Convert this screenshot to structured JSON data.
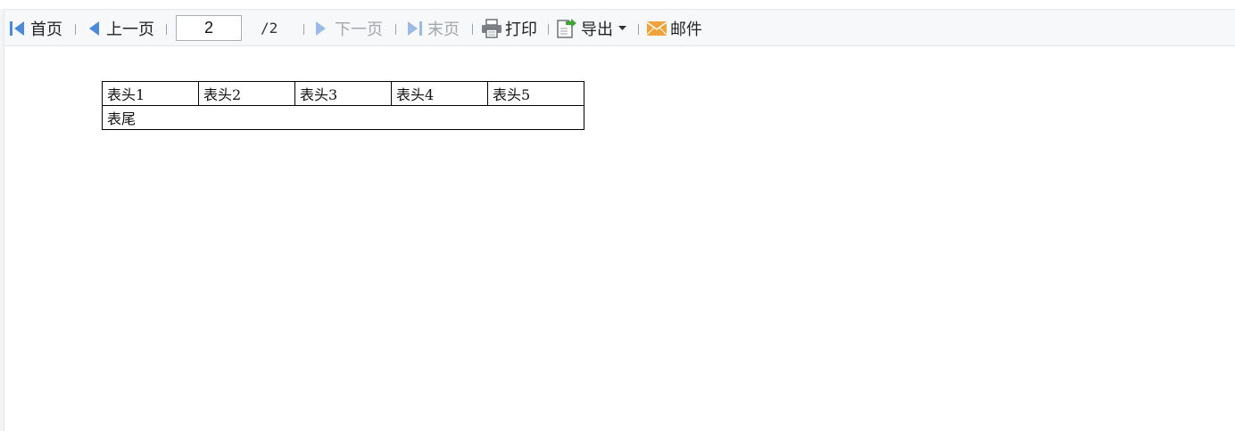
{
  "toolbar": {
    "first_label": "首页",
    "prev_label": "上一页",
    "current_page": "2",
    "total_pages": "/2",
    "next_label": "下一页",
    "last_label": "末页",
    "print_label": "打印",
    "export_label": "导出",
    "mail_label": "邮件"
  },
  "report": {
    "headers": [
      "表头1",
      "表头2",
      "表头3",
      "表头4",
      "表头5"
    ],
    "footer": "表尾"
  },
  "colors": {
    "nav_icon": "#4a89dc",
    "nav_icon_disabled": "#9bbbe6",
    "toolbar_bg": "#f7f8fa",
    "export_accent": "#3fa535",
    "mail_icon": "#f0a33a"
  }
}
